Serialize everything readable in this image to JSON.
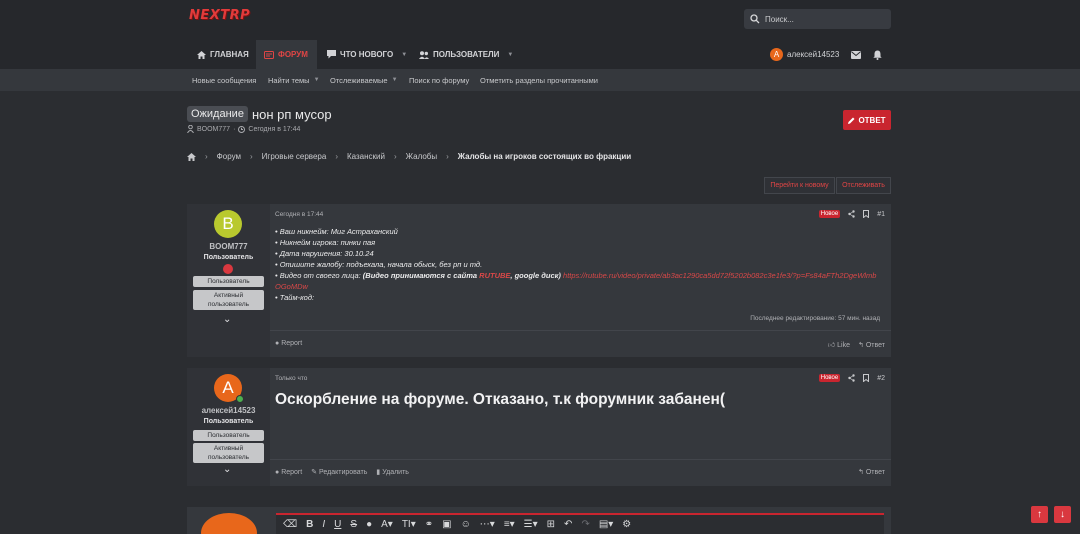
{
  "header": {
    "logo_text": "NEXTRP",
    "search_placeholder": "Поиск..."
  },
  "nav": {
    "items": [
      {
        "label": "ГЛАВНАЯ"
      },
      {
        "label": "ФОРУМ"
      },
      {
        "label": "ЧТО НОВОГО"
      },
      {
        "label": "ПОЛЬЗОВАТЕЛИ"
      }
    ],
    "user": {
      "avatar_letter": "А",
      "name": "алексей14523"
    }
  },
  "subnav": {
    "items": [
      "Новые сообщения",
      "Найти темы",
      "Отслеживаемые",
      "Поиск по форуму",
      "Отметить разделы прочитанными"
    ]
  },
  "thread": {
    "prefix": "Ожидание",
    "title": "нон рп мусор",
    "author": "BOOM777",
    "sep": "·",
    "date": "Сегодня в 17:44",
    "reply_label": "ОТВЕТ"
  },
  "breadcrumb": [
    "Форум",
    "Игровые сервера",
    "Казанский",
    "Жалобы",
    "Жалобы на игроков состоящих во фракции"
  ],
  "buttons": {
    "goto_new": "Перейти к новому",
    "watch": "Отслеживать"
  },
  "posts": [
    {
      "avatar_letter": "B",
      "avatar_color": "#b9c92e",
      "username": "BOOM777",
      "usertitle": "Пользователь",
      "banners": [
        "Пользователь",
        "Активный пользователь"
      ],
      "date": "Сегодня в 17:44",
      "new_badge": "Новое",
      "number": "#1",
      "lines": [
        "• Ваш никнейм: Миг Астраханский",
        "• Никнейм игрока: пинки пая",
        "• Дата нарушения: 30.10.24",
        "• Опишите жалобу: подъехала, начала обыск, без рп и тд.",
        "• Видео от своего лица: ",
        "(Видео принимаются с сайта ",
        "RUTUBE",
        ", google диск)",
        "https://rutube.ru/video/private/ab3ac1290ca5dd72f5202b082c3e1fe3/?p=Fs84aFTh2DgeWlmbOGoMDw",
        "• Тайм-код:"
      ],
      "edit_note": "Последнее редактирование: 57 мин. назад",
      "report": "Report",
      "like": "Like",
      "reply": "Ответ"
    },
    {
      "avatar_letter": "А",
      "avatar_color": "#e8671b",
      "username": "алексей14523",
      "usertitle": "Пользователь",
      "banners": [
        "Пользователь",
        "Активный пользователь"
      ],
      "date": "Только что",
      "new_badge": "Новое",
      "number": "#2",
      "message": "Оскорбление на форуме. Отказано, т.к форумник забанен(",
      "report": "Report",
      "edit": "Редактировать",
      "delete": "Удалить",
      "reply": "Ответ"
    }
  ],
  "colors": {
    "accent": "#c9252f",
    "link": "#d94848",
    "background": "#2b2d31"
  }
}
